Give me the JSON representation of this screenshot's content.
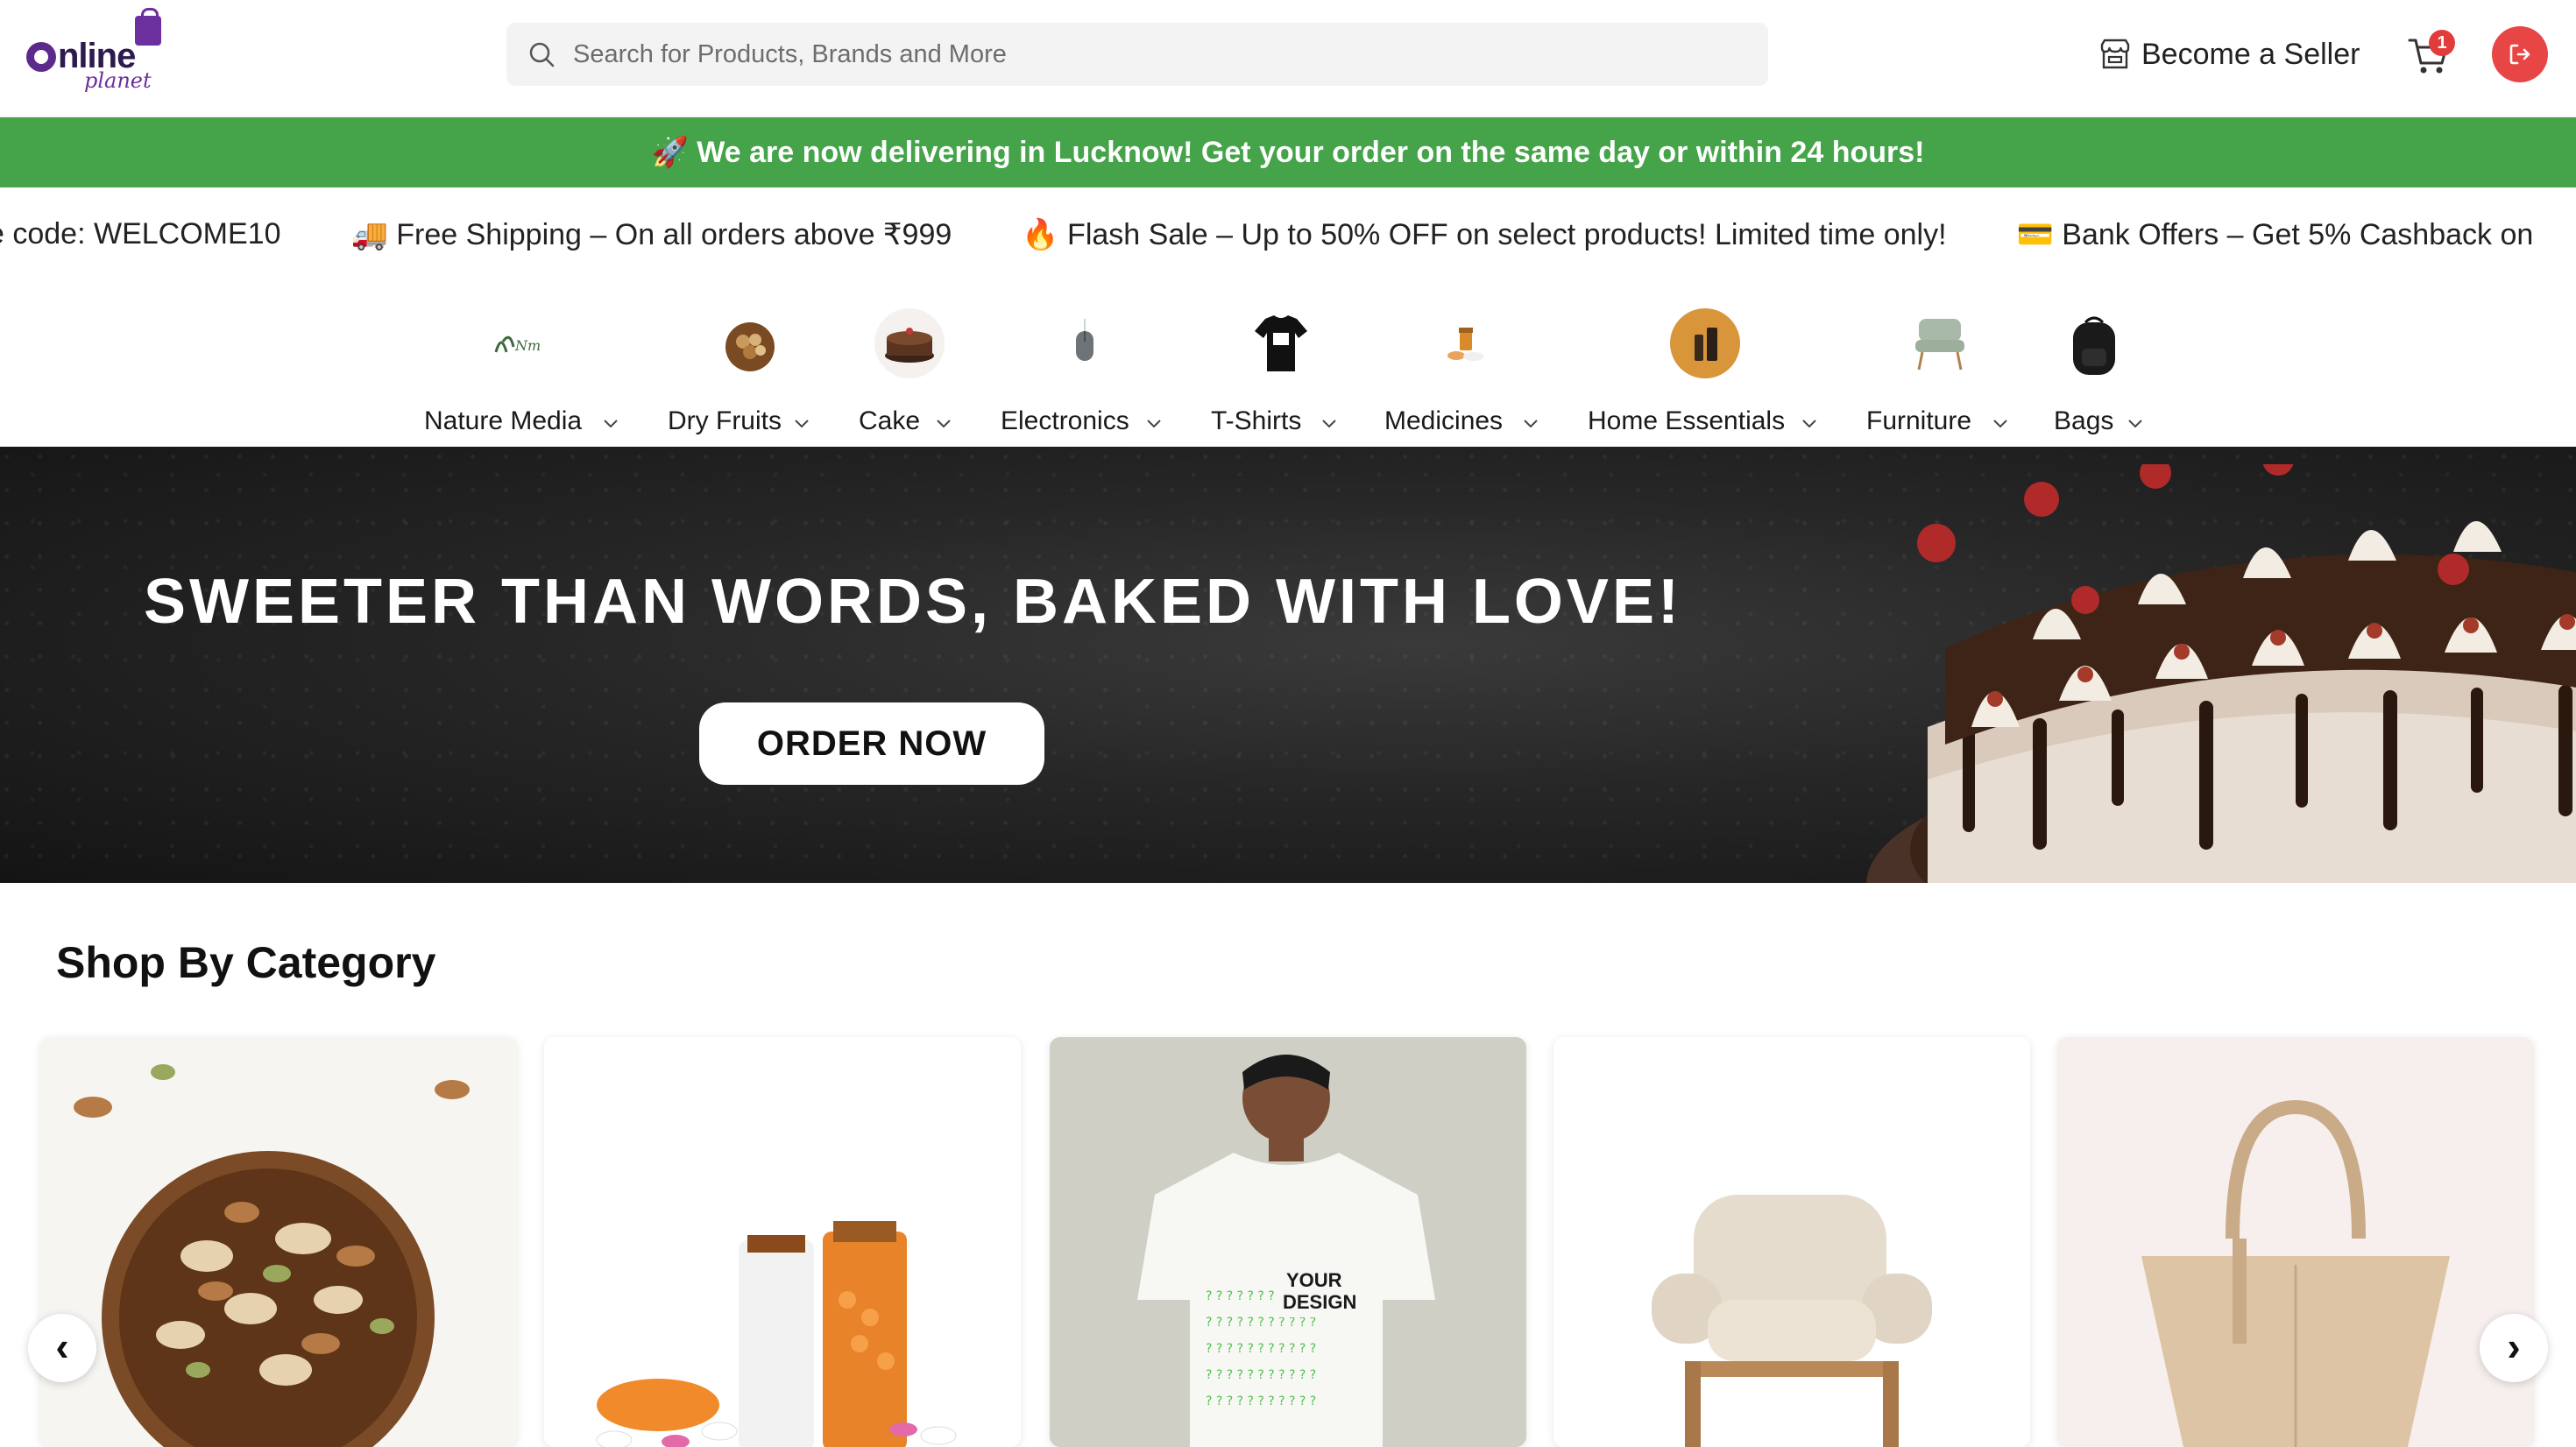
{
  "header": {
    "logo_text": "nline",
    "logo_sub": "planet",
    "search_placeholder": "Search for Products, Brands and More",
    "seller_label": "Become a Seller",
    "cart_count": "1"
  },
  "announcement": "🚀 We are now delivering in Lucknow! Get your order on the same day or within 24 hours!",
  "ticker": [
    "e code: WELCOME10",
    "🚚 Free Shipping – On all orders above ₹999",
    "🔥 Flash Sale – Up to 50% OFF on select products! Limited time only!",
    "💳 Bank Offers – Get 5% Cashback on"
  ],
  "categories": [
    {
      "label": "Nature Media",
      "icon": "nature-media-logo"
    },
    {
      "label": "Dry Fruits",
      "icon": "dry-fruits-image"
    },
    {
      "label": "Cake",
      "icon": "cake-image"
    },
    {
      "label": "Electronics",
      "icon": "mouse-image"
    },
    {
      "label": "T-Shirts",
      "icon": "tshirt-image"
    },
    {
      "label": "Medicines",
      "icon": "medicines-image"
    },
    {
      "label": "Home Essentials",
      "icon": "home-essentials-image"
    },
    {
      "label": "Furniture",
      "icon": "chair-image"
    },
    {
      "label": "Bags",
      "icon": "backpack-image"
    }
  ],
  "hero": {
    "title": "SWEETER THAN WORDS, BAKED WITH LOVE!",
    "button": "ORDER NOW"
  },
  "shop_by_category": {
    "title": "Shop By Category",
    "prev": "‹",
    "next": "›",
    "t_shirt_print": [
      "YOUR",
      "DESIGN"
    ]
  },
  "colors": {
    "announcement_bg": "#45a349",
    "logout_bg": "#e84545",
    "brand_purple": "#6b2f9e"
  }
}
